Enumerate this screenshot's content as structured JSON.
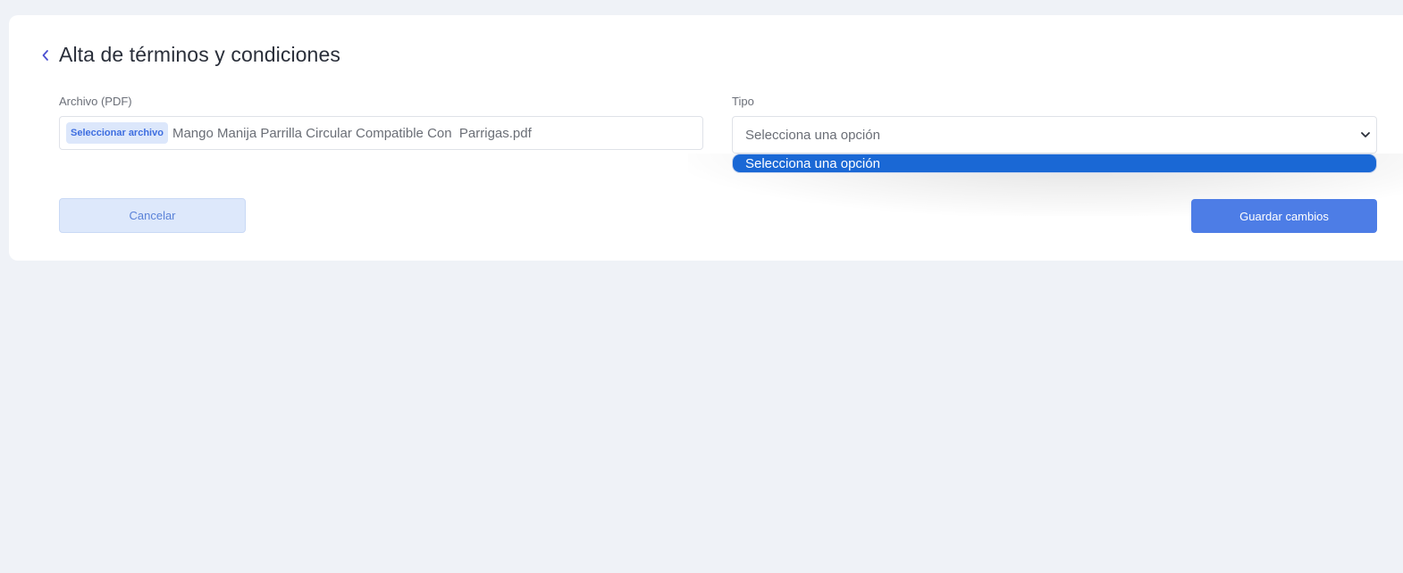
{
  "page": {
    "title": "Alta de términos y condiciones",
    "back_icon": "chevron-left-icon"
  },
  "form": {
    "file_field": {
      "label": "Archivo (PDF)",
      "button_label": "Seleccionar archivo",
      "file_name": "Mango Manija Parrilla Circular Compatible Con  Parrigas.pdf"
    },
    "type_field": {
      "label": "Tipo",
      "selected_value": "Selecciona una opción",
      "options": [
        "Selecciona una opción"
      ],
      "dropdown_open": true,
      "chevron_icon": "chevron-down-icon"
    }
  },
  "actions": {
    "cancel_label": "Cancelar",
    "save_label": "Guardar cambios"
  },
  "colors": {
    "accent": "#4d7de6",
    "highlight": "#1a68d5",
    "background": "#eff2f7"
  }
}
